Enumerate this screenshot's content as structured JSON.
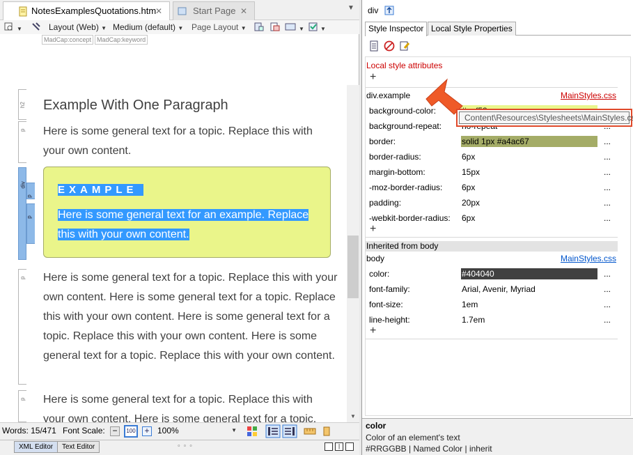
{
  "tabs": [
    {
      "label": "NotesExamplesQuotations.htm",
      "active": true
    },
    {
      "label": "Start Page",
      "active": false
    }
  ],
  "toolbar": {
    "layout": "Layout (Web)",
    "medium": "Medium (default)",
    "page_layout": "Page Layout"
  },
  "concepts": [
    "MadCap:concept",
    "MadCap:keyword"
  ],
  "gutter": {
    "h2": "h2",
    "p": "p",
    "div": "div"
  },
  "document": {
    "heading": "Example With One Paragraph",
    "para1": "Here is some general text for a topic. Replace this with your own content.",
    "example_heading": "EXAMPLE",
    "example_text": "Here is some general text for an example. Replace this with your own content.",
    "para2": "Here is some general text for a topic. Replace this with your own content. Here is some general text for a topic. Replace this with your own content. Here is some general text for a topic. Replace this with your own content. Here is some general text for a topic. Replace this with your own content.",
    "para3": "Here is some general text for a topic. Replace this with your own content. Here is some general text for a topic."
  },
  "status": {
    "words": "Words: 15/471",
    "font_scale_label": "Font Scale:",
    "zoom": "100%"
  },
  "bottom_tabs": [
    "XML Editor",
    "Text Editor"
  ],
  "inspector": {
    "element": "div",
    "tabs": [
      "Style Inspector",
      "Local Style Properties"
    ],
    "local_attrs_title": "Local style attributes",
    "rule_selector": "div.example",
    "rule_source": "MainStyles.css",
    "properties": [
      {
        "name": "background-color:",
        "value": "#eaf58a",
        "swatch": "#eaf58a",
        "text_color": "#000000"
      },
      {
        "name": "background-repeat:",
        "value": "no-repeat",
        "swatch": "",
        "text_color": "#000000"
      },
      {
        "name": "border:",
        "value": "solid 1px #a4ac67",
        "swatch": "#a4ac67",
        "text_color": "#000000"
      },
      {
        "name": "border-radius:",
        "value": "6px",
        "swatch": "",
        "text_color": "#000000"
      },
      {
        "name": "margin-bottom:",
        "value": "15px",
        "swatch": "",
        "text_color": "#000000"
      },
      {
        "name": "-moz-border-radius:",
        "value": "6px",
        "swatch": "",
        "text_color": "#000000"
      },
      {
        "name": "padding:",
        "value": "20px",
        "swatch": "",
        "text_color": "#000000"
      },
      {
        "name": "-webkit-border-radius:",
        "value": "6px",
        "swatch": "",
        "text_color": "#000000"
      }
    ],
    "inherited_title": "Inherited from body",
    "inherited_selector": "body",
    "inherited_source": "MainStyles.css",
    "inherited_properties": [
      {
        "name": "color:",
        "value": "#404040",
        "swatch": "#404040",
        "text_color": "#ffffff"
      },
      {
        "name": "font-family:",
        "value": "Arial, Avenir, Myriad",
        "swatch": "",
        "text_color": "#000000"
      },
      {
        "name": "font-size:",
        "value": "1em",
        "swatch": "",
        "text_color": "#000000"
      },
      {
        "name": "line-height:",
        "value": "1.7em",
        "swatch": "",
        "text_color": "#000000"
      }
    ],
    "tooltip": "Content\\Resources\\Stylesheets\\MainStyles.css",
    "desc_title": "color",
    "desc_text": "Color of an element's text",
    "desc_values": "#RRGGBB | Named Color | inherit"
  },
  "colors": {
    "accent_red": "#cc0000",
    "link_blue": "#0055cc",
    "selection": "#3399ff",
    "example_bg": "#eaf58a"
  }
}
